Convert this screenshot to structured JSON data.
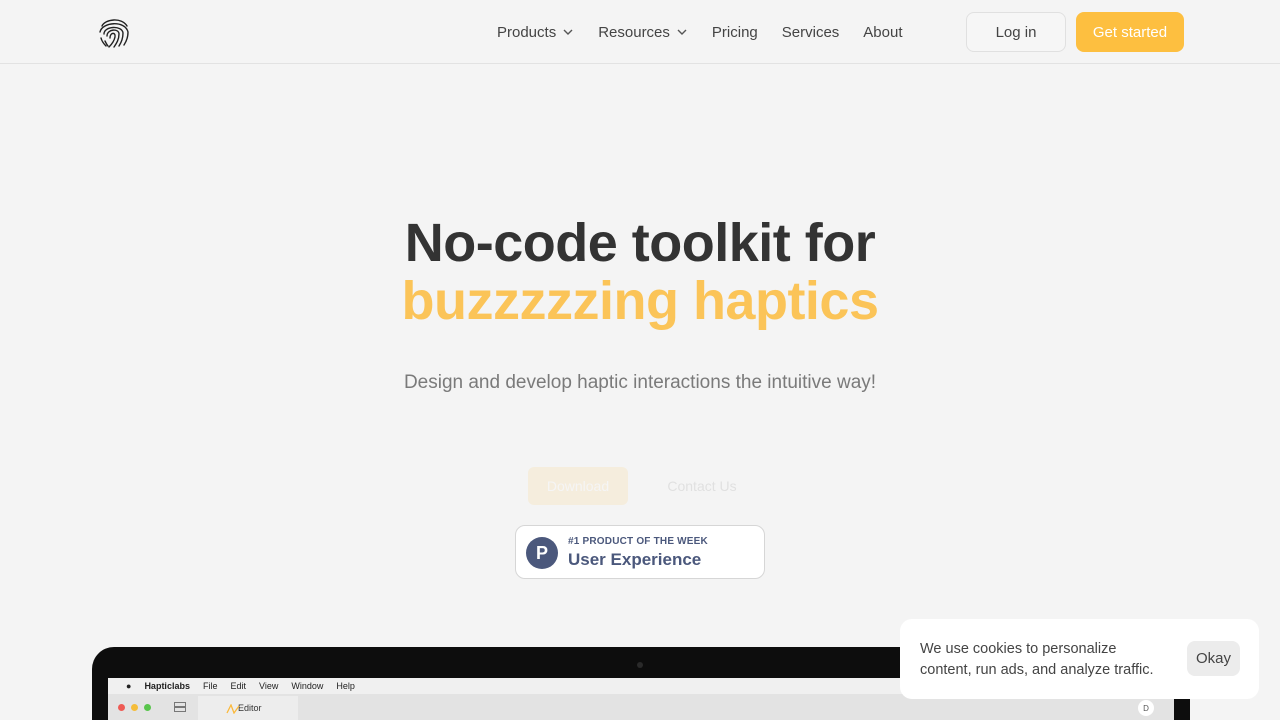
{
  "header": {
    "logo_icon": "fingerprint-icon",
    "nav": [
      {
        "label": "Products",
        "has_dropdown": true
      },
      {
        "label": "Resources",
        "has_dropdown": true
      },
      {
        "label": "Pricing",
        "has_dropdown": false
      },
      {
        "label": "Services",
        "has_dropdown": false
      },
      {
        "label": "About",
        "has_dropdown": false
      }
    ],
    "login_label": "Log in",
    "get_started_label": "Get started"
  },
  "hero": {
    "title_line1": "No-code toolkit for",
    "title_line2": "buzzzzzing haptics",
    "subtitle": "Design and develop haptic interactions the intuitive way!",
    "download_label": "Download",
    "contact_label": "Contact Us"
  },
  "badge": {
    "letter": "P",
    "top_text": "#1 PRODUCT OF THE WEEK",
    "main_text": "User Experience"
  },
  "mockup": {
    "menu": {
      "app": "Hapticlabs",
      "items": [
        "File",
        "Edit",
        "View",
        "Window",
        "Help"
      ]
    },
    "tab_label": "Editor",
    "tab_badge": "D"
  },
  "cookie": {
    "message": "We use cookies to personalize content, run ads, and analyze traffic.",
    "button_label": "Okay"
  },
  "colors": {
    "accent": "#fdbf40",
    "accent_text": "#fbc458",
    "badge": "#4b587c",
    "background": "#f4f4f4"
  }
}
